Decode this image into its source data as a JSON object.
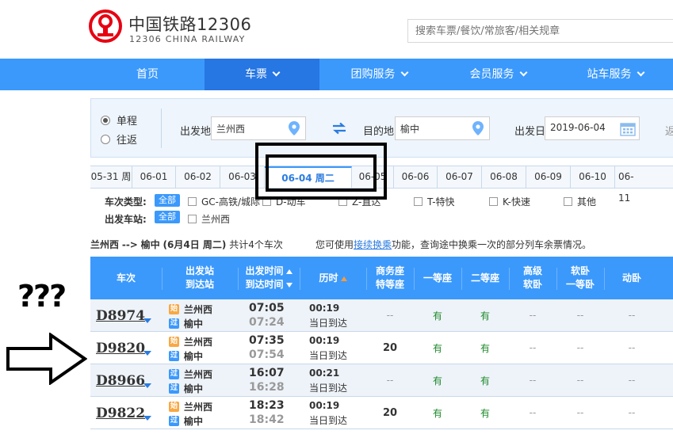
{
  "header": {
    "brand_cn": "中国铁路12306",
    "brand_en": "12306 CHINA RAILWAY",
    "search_placeholder": "搜索车票/餐饮/常旅客/相关规章"
  },
  "nav": {
    "items": [
      {
        "label": "首页"
      },
      {
        "label": "车票"
      },
      {
        "label": "团购服务"
      },
      {
        "label": "会员服务"
      },
      {
        "label": "站车服务"
      }
    ]
  },
  "search_panel": {
    "trip_one_way": "单程",
    "trip_round": "往返",
    "from_label": "出发地",
    "from_value": "兰州西",
    "to_label": "目的地",
    "to_value": "榆中",
    "date_label": "出发日",
    "date_value": "2019-06-04",
    "cut_text": "返"
  },
  "date_tabs": [
    "05-31 周",
    "06-01",
    "06-02",
    "06-03",
    "06-04 周二",
    "06-05",
    "06-06",
    "06-07",
    "06-08",
    "06-09",
    "06-10",
    "06-11"
  ],
  "filters": {
    "type_label": "车次类型:",
    "all_label": "全部",
    "types": [
      "GC-高铁/城际",
      "D-动车",
      "Z-直达",
      "T-特快",
      "K-快速",
      "其他"
    ],
    "station_label": "出发车站:",
    "stations": [
      "兰州西"
    ]
  },
  "route": {
    "from": "兰州西",
    "arrow": "-->",
    "to": "榆中",
    "date_text": "(6月4日 周二)",
    "count_text": "共计4个车次",
    "note_prefix": "您可使用",
    "note_link": "接续换乘",
    "note_suffix": "功能，查询途中换乘一次的部分列车余票情况。"
  },
  "table": {
    "headers": {
      "train": "车次",
      "station_1": "出发站",
      "station_2": "到达站",
      "time_1": "出发时间",
      "time_2": "到达时间",
      "duration": "历时",
      "business_1": "商务座",
      "business_2": "特等座",
      "first": "一等座",
      "second": "二等座",
      "deluxe_1": "高级",
      "deluxe_2": "软卧",
      "soft_1": "软卧",
      "soft_2": "一等卧",
      "moving": "动卧"
    },
    "tags": {
      "start": "始",
      "pass": "过"
    },
    "rows": [
      {
        "train": "D8974",
        "from_tag": "始",
        "from": "兰州西",
        "to_tag": "过",
        "to": "榆中",
        "dep": "07:05",
        "arr": "07:24",
        "dur": "00:19",
        "arrive_note": "当日到达",
        "business": "--",
        "first": "有",
        "second": "有",
        "deluxe": "--",
        "soft": "--",
        "moving": "--"
      },
      {
        "train": "D9820",
        "from_tag": "始",
        "from": "兰州西",
        "to_tag": "过",
        "to": "榆中",
        "dep": "07:35",
        "arr": "07:54",
        "dur": "00:19",
        "arrive_note": "当日到达",
        "business": "20",
        "first": "有",
        "second": "有",
        "deluxe": "--",
        "soft": "--",
        "moving": "--"
      },
      {
        "train": "D8966",
        "from_tag": "过",
        "from": "兰州西",
        "to_tag": "过",
        "to": "榆中",
        "dep": "16:07",
        "arr": "16:28",
        "dur": "00:21",
        "arrive_note": "当日到达",
        "business": "--",
        "first": "有",
        "second": "有",
        "deluxe": "--",
        "soft": "--",
        "moving": "--"
      },
      {
        "train": "D9822",
        "from_tag": "始",
        "from": "兰州西",
        "to_tag": "过",
        "to": "榆中",
        "dep": "18:23",
        "arr": "18:42",
        "dur": "00:19",
        "arrive_note": "当日到达",
        "business": "20",
        "first": "有",
        "second": "有",
        "deluxe": "--",
        "soft": "--",
        "moving": "--"
      }
    ]
  },
  "annotation": {
    "question": "???"
  },
  "colors": {
    "brand_red": "#e60012",
    "nav_blue": "#3b99fc",
    "nav_active": "#2676e3",
    "available_green": "#1e8a2a",
    "start_tag": "#f8a843"
  }
}
